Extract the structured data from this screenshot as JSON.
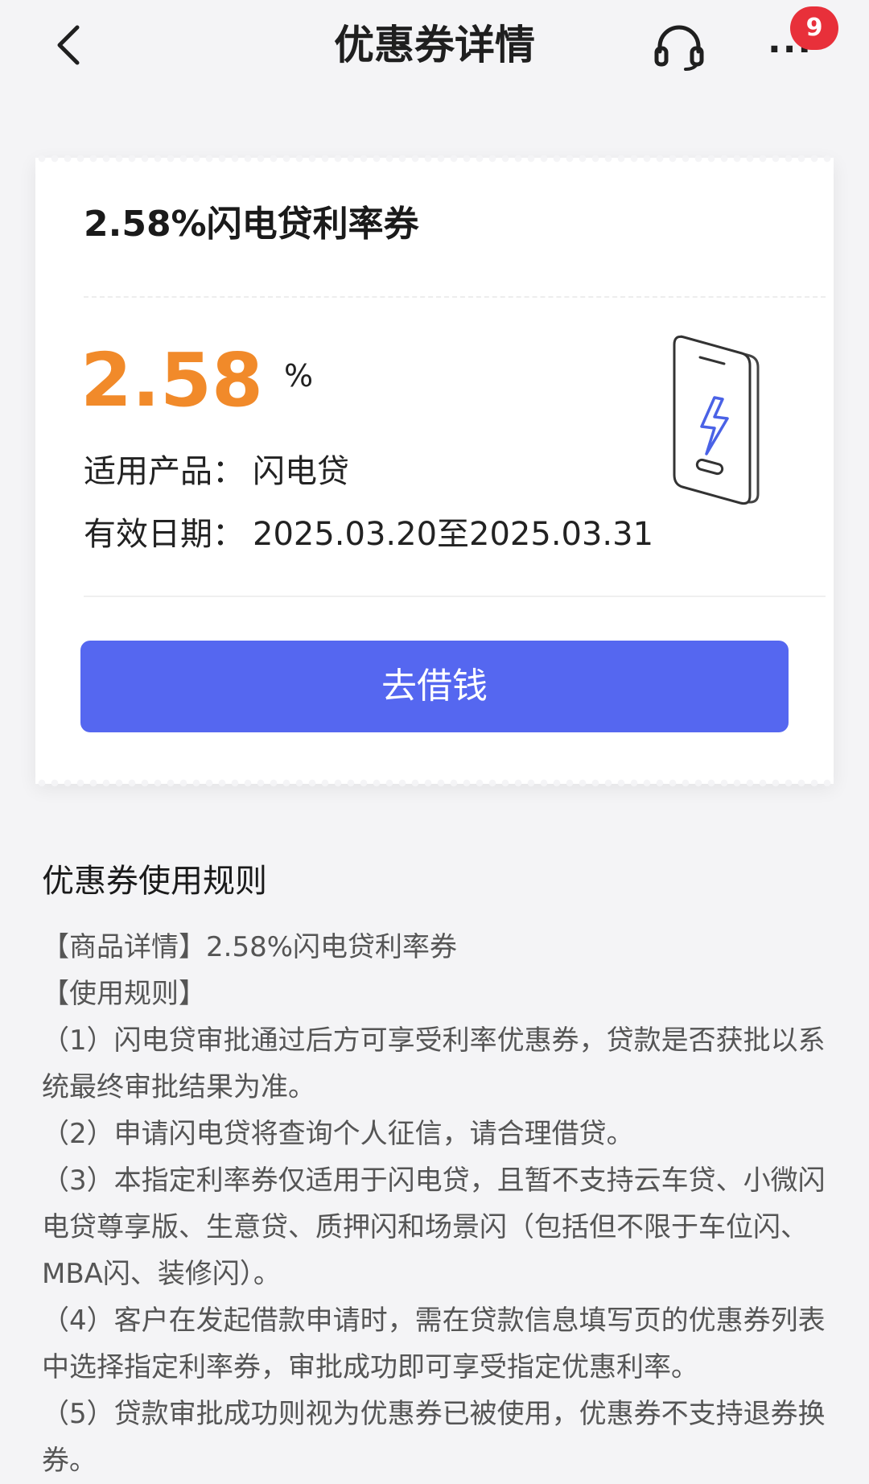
{
  "header": {
    "title": "优惠券详情",
    "badge_count": "9",
    "more_symbol": "···",
    "icons": {
      "back": "back-chevron-icon",
      "support": "headset-icon",
      "more": "more-dots-icon"
    }
  },
  "coupon": {
    "title": "2.58%闪电贷利率券",
    "rate_value": "2.58",
    "rate_unit": "%",
    "product_label": "适用产品：",
    "product_value": "闪电贷",
    "validity_label": "有效日期：",
    "validity_value": "2025.03.20至2025.03.31",
    "button_label": "去借钱",
    "illustration": "phone-lightning-icon"
  },
  "rules": {
    "heading": "优惠券使用规则",
    "lines": [
      "【商品详情】2.58%闪电贷利率券",
      "【使用规则】",
      "（1）闪电贷审批通过后方可享受利率优惠券，贷款是否获批以系统最终审批结果为准。",
      "（2）申请闪电贷将查询个人征信，请合理借贷。",
      "（3）本指定利率券仅适用于闪电贷，且暂不支持云车贷、小微闪电贷尊享版、生意贷、质押闪和场景闪（包括但不限于车位闪、MBA闪、装修闪）。",
      "（4）客户在发起借款申请时，需在贷款信息填写页的优惠券列表中选择指定利率券，审批成功即可享受指定优惠利率。",
      "（5）贷款审批成功则视为优惠券已被使用，优惠券不支持退券换券。"
    ]
  },
  "colors": {
    "accent_orange": "#f18a2a",
    "button_blue": "#5567f0",
    "badge_red": "#e8303a",
    "page_bg": "#f4f4f6"
  }
}
